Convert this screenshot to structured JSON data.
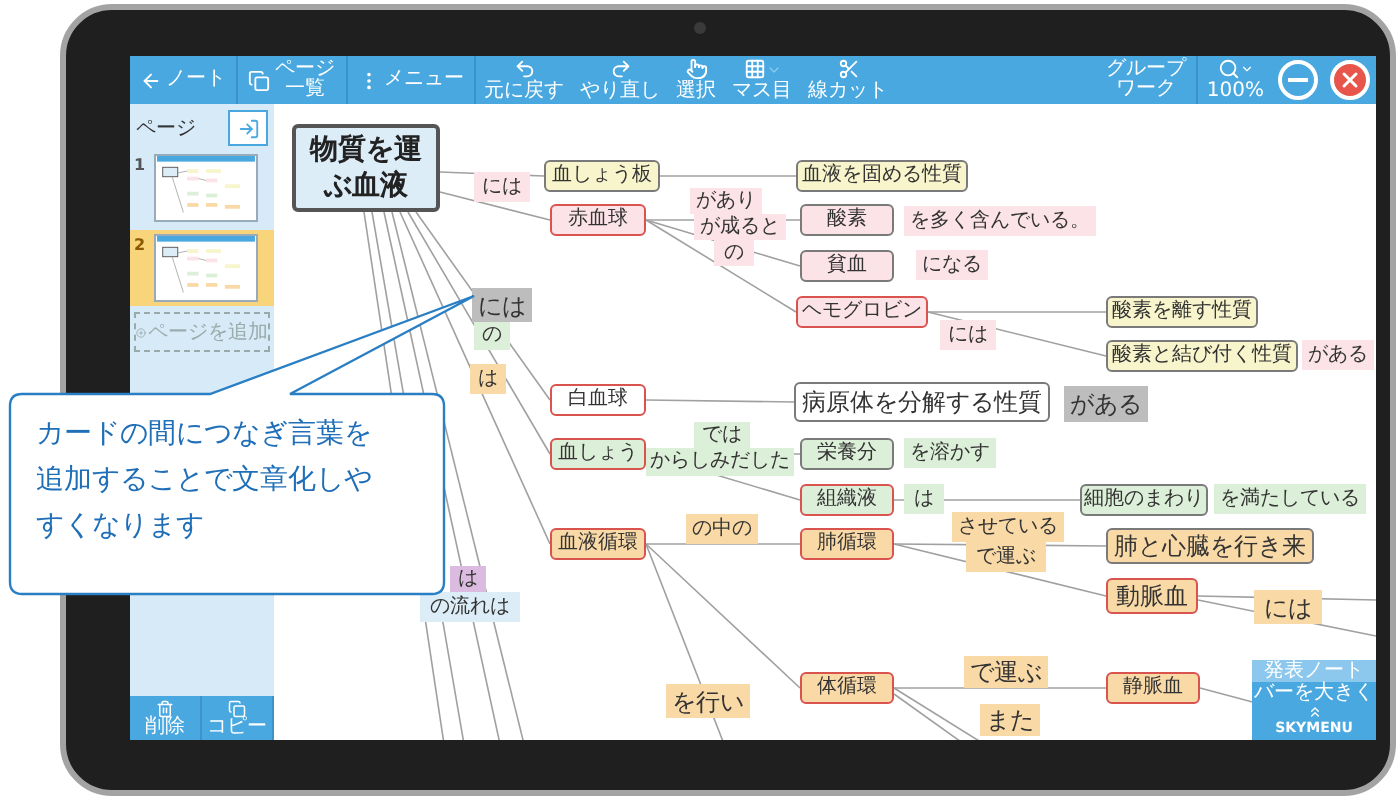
{
  "toolbar": {
    "items": [
      {
        "kind": "back",
        "label": "ノート"
      },
      {
        "kind": "pages",
        "label": "ページ一覧"
      },
      {
        "kind": "menu",
        "label": "メニュー"
      },
      {
        "kind": "undo",
        "label": "元に戻す"
      },
      {
        "kind": "redo",
        "label": "やり直し"
      },
      {
        "kind": "select",
        "label": "選択"
      },
      {
        "kind": "grid",
        "label": "マス目"
      },
      {
        "kind": "cut",
        "label": "線カット"
      },
      {
        "kind": "group",
        "label": "グループワーク"
      },
      {
        "kind": "zoom",
        "label": "100%"
      },
      {
        "kind": "minimize"
      },
      {
        "kind": "close"
      }
    ]
  },
  "sidebar": {
    "title": "ページ",
    "pages": [
      {
        "number": "1",
        "selected": false
      },
      {
        "number": "2",
        "selected": true
      }
    ],
    "add_page": "ページを追加",
    "actions": [
      {
        "kind": "delete",
        "label": "削除"
      },
      {
        "kind": "copy",
        "label": "コピー"
      }
    ]
  },
  "map": {
    "title": "物質を運ぶ血液",
    "cards": [
      {
        "text": "血しょう板",
        "color": "#f8f5cc",
        "kind": "detail"
      },
      {
        "text": "血液を固める性質",
        "color": "#f8f5cc",
        "kind": "detail"
      },
      {
        "text": "赤血球",
        "color": "#fbe3e8",
        "kind": "topic"
      },
      {
        "text": "酸素",
        "color": "#fbe3e8",
        "kind": "detail"
      },
      {
        "text": "貧血",
        "color": "#fbe3e8",
        "kind": "detail"
      },
      {
        "text": "ヘモグロビン",
        "color": "#fbe3e8",
        "kind": "topic"
      },
      {
        "text": "酸素を離す性質",
        "color": "#f8f5cc",
        "kind": "detail"
      },
      {
        "text": "酸素と結び付く性質",
        "color": "#f8f5cc",
        "kind": "detail"
      },
      {
        "text": "白血球",
        "color": "#ffffff",
        "kind": "topic"
      },
      {
        "text": "病原体を分解する性質",
        "color": "#ffffff",
        "kind": "detail"
      },
      {
        "text": "血しょう",
        "color": "#dcefd8",
        "kind": "topic"
      },
      {
        "text": "栄養分",
        "color": "#dcefd8",
        "kind": "detail"
      },
      {
        "text": "組織液",
        "color": "#dcefd8",
        "kind": "topic"
      },
      {
        "text": "細胞のまわり",
        "color": "#dcefd8",
        "kind": "detail"
      },
      {
        "text": "血液循環",
        "color": "#f9d9a6",
        "kind": "topic"
      },
      {
        "text": "肺循環",
        "color": "#f9d9a6",
        "kind": "topic"
      },
      {
        "text": "肺と心臓を行き来",
        "color": "#f9d9a6",
        "kind": "detail"
      },
      {
        "text": "動脈血",
        "color": "#f9d9a6",
        "kind": "topic"
      },
      {
        "text": "体循環",
        "color": "#f9d9a6",
        "kind": "topic"
      },
      {
        "text": "静脈血",
        "color": "#f9d9a6",
        "kind": "topic"
      }
    ],
    "links": [
      {
        "text": "には",
        "color": "#fbe3e8"
      },
      {
        "text": "があり",
        "color": "#fbe3e8"
      },
      {
        "text": "が成ると",
        "color": "#fbe3e8"
      },
      {
        "text": "の",
        "color": "#fbe3e8"
      },
      {
        "text": "を多く含んでいる。",
        "color": "#fbe3e8"
      },
      {
        "text": "になる",
        "color": "#fbe3e8"
      },
      {
        "text": "には",
        "color": "#fbe3e8"
      },
      {
        "text": "がある",
        "color": "#fbe3e8"
      },
      {
        "text": "には",
        "color": "#bdbdbd"
      },
      {
        "text": "の",
        "color": "#dcefd8"
      },
      {
        "text": "は",
        "color": "#f9d9a6"
      },
      {
        "text": "がある",
        "color": "#bdbdbd"
      },
      {
        "text": "では",
        "color": "#dcefd8"
      },
      {
        "text": "からしみだした",
        "color": "#dcefd8"
      },
      {
        "text": "を溶かす",
        "color": "#dcefd8"
      },
      {
        "text": "は",
        "color": "#dcefd8"
      },
      {
        "text": "を満たしている",
        "color": "#dcefd8"
      },
      {
        "text": "の中の",
        "color": "#f9d9a6"
      },
      {
        "text": "させている",
        "color": "#f9d9a6"
      },
      {
        "text": "で運ぶ",
        "color": "#f9d9a6"
      },
      {
        "text": "は",
        "color": "#dcbbe0"
      },
      {
        "text": "には",
        "color": "#f9d9a6"
      },
      {
        "text": "の流れは",
        "color": "#dcedf8"
      },
      {
        "text": "で運ぶ",
        "color": "#f9d9a6"
      },
      {
        "text": "を行い",
        "color": "#f9d9a6"
      },
      {
        "text": "また",
        "color": "#f9d9a6"
      }
    ]
  },
  "callout": {
    "text": "カードの間につなぎ言葉を追加することで文章化しやすくなります"
  },
  "widget": {
    "header": "発表ノート",
    "label": "バーを大きく",
    "brand": "SKYMENU"
  }
}
